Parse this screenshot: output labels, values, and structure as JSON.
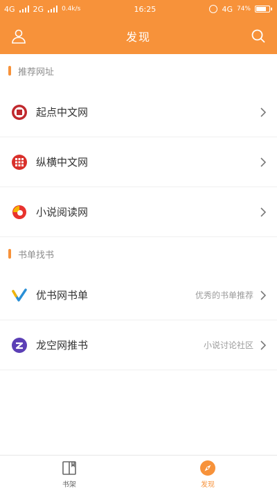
{
  "status": {
    "left_net1": "4G",
    "left_net2": "2G",
    "speed": "0.4k/s",
    "time": "16:25",
    "right_net": "4G",
    "battery_pct": "74%"
  },
  "header": {
    "title": "发现",
    "user_icon": "user-icon",
    "search_icon": "search-icon"
  },
  "sections": [
    {
      "title": "推荐网址",
      "items": [
        {
          "name": "起点中文网",
          "desc": "",
          "icon": "qidian-logo-icon"
        },
        {
          "name": "纵横中文网",
          "desc": "",
          "icon": "zongheng-logo-icon"
        },
        {
          "name": "小说阅读网",
          "desc": "",
          "icon": "xiaoshuo-logo-icon"
        }
      ]
    },
    {
      "title": "书单找书",
      "items": [
        {
          "name": "优书网书单",
          "desc": "优秀的书单推荐",
          "icon": "youshu-logo-icon"
        },
        {
          "name": "龙空网推书",
          "desc": "小说讨论社区",
          "icon": "longkong-logo-icon"
        }
      ]
    }
  ],
  "tabs": [
    {
      "label": "书架",
      "icon": "bookshelf-icon",
      "active": false
    },
    {
      "label": "发现",
      "icon": "compass-icon",
      "active": true
    }
  ],
  "colors": {
    "accent": "#f7923a",
    "divider": "#efefef",
    "qidian_red": "#c0282d",
    "zongheng_red": "#d9302b",
    "youshu_blue": "#2a8fd6",
    "longkong_purple": "#5b3fb5"
  }
}
